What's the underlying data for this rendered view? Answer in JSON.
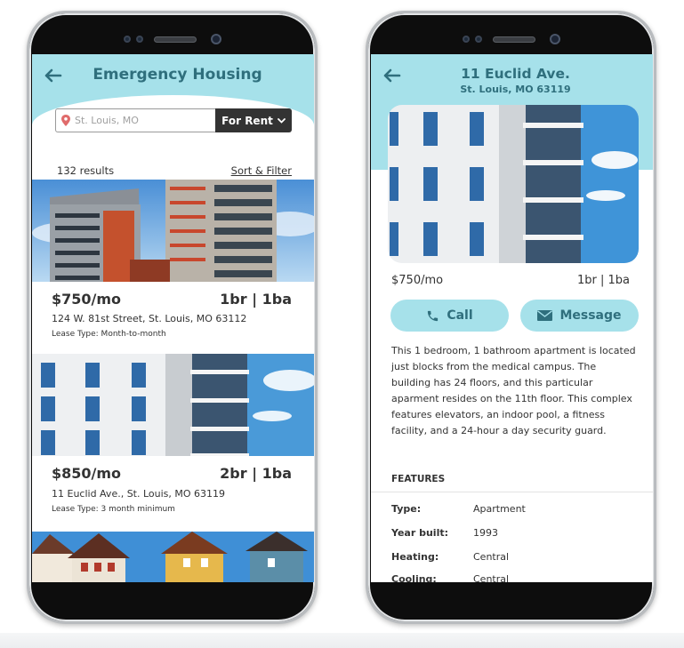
{
  "left_phone": {
    "header": {
      "title": "Emergency Housing"
    },
    "search": {
      "placeholder": "St. Louis, MO",
      "dropdown_label": "For Rent"
    },
    "results": {
      "count_text": "132 results",
      "sort_filter_label": "Sort & Filter"
    },
    "listings": [
      {
        "price": "$750/mo",
        "beds_baths": "1br | 1ba",
        "address": "124 W. 81st Street, St. Louis, MO 63112",
        "lease": "Lease Type: Month-to-month"
      },
      {
        "price": "$850/mo",
        "beds_baths": "2br | 1ba",
        "address": "11 Euclid Ave., St. Louis, MO 63119",
        "lease": "Lease Type: 3 month minimum"
      }
    ]
  },
  "right_phone": {
    "header": {
      "title": "11 Euclid Ave.",
      "subtitle": "St. Louis, MO 63119"
    },
    "price": "$750/mo",
    "beds_baths": "1br | 1ba",
    "call_label": "Call",
    "message_label": "Message",
    "description": "This 1 bedroom, 1 bathroom apartment is located just blocks from the medical campus.  The building has 24 floors, and this particular aparment resides on the 11th floor.  This complex features elevators, an indoor pool, a fitness facility, and a 24-hour a day security guard.",
    "features_title": "FEATURES",
    "features": [
      {
        "key": "Type:",
        "value": "Apartment"
      },
      {
        "key": "Year built:",
        "value": "1993"
      },
      {
        "key": "Heating:",
        "value": "Central"
      },
      {
        "key": "Cooling:",
        "value": "Central"
      }
    ]
  },
  "colors": {
    "accent": "#a6e1ea",
    "accent_text": "#2f6f7d",
    "dark_button": "#333333",
    "pin": "#e06b6b"
  },
  "icons": [
    "back-arrow-icon",
    "location-pin-icon",
    "chevron-down-icon",
    "phone-icon",
    "envelope-icon"
  ]
}
